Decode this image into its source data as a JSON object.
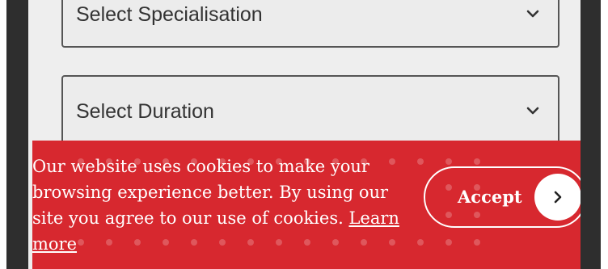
{
  "form": {
    "specialisation_placeholder": "Select Specialisation",
    "duration_placeholder": "Select Duration"
  },
  "cookie_banner": {
    "message": "Our website uses cookies to make your browsing experience better. By using our site you agree to our use of cookies.",
    "learn_more_label": "Learn more",
    "accept_label": "Accept",
    "background_color": "#d7282f",
    "text_color": "#ffffff"
  },
  "icons": {
    "dropdown_chevron": "chevron-down-icon",
    "accept_arrow": "chevron-right-icon"
  }
}
